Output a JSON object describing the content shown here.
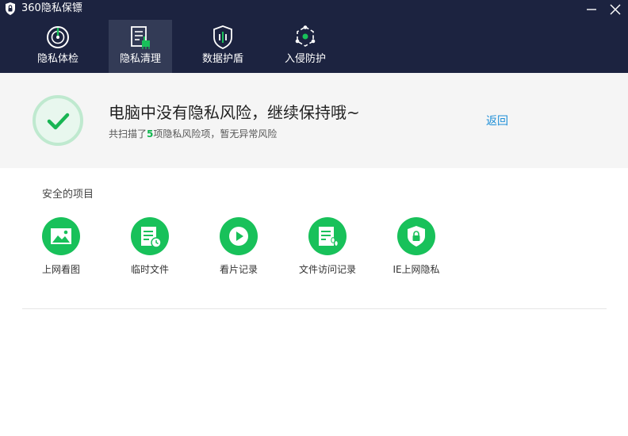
{
  "app": {
    "title": "360隐私保镖"
  },
  "tabs": [
    {
      "label": "隐私体检",
      "icon": "radar-icon"
    },
    {
      "label": "隐私清理",
      "icon": "clean-document-icon"
    },
    {
      "label": "数据护盾",
      "icon": "shield-icon"
    },
    {
      "label": "入侵防护",
      "icon": "network-guard-icon"
    }
  ],
  "active_tab": "隐私清理",
  "result": {
    "title": "电脑中没有隐私风险，继续保持哦~",
    "sub_prefix": "共扫描了",
    "count": "5",
    "sub_suffix": "项隐私风险项，暂无异常风险",
    "back_label": "返回"
  },
  "safe_section": {
    "title": "安全的项目",
    "items": [
      {
        "label": "上网看图",
        "icon": "image-icon"
      },
      {
        "label": "临时文件",
        "icon": "temp-file-icon"
      },
      {
        "label": "看片记录",
        "icon": "play-icon"
      },
      {
        "label": "文件访问记录",
        "icon": "file-footprint-icon"
      },
      {
        "label": "IE上网隐私",
        "icon": "shield-lock-icon"
      }
    ]
  },
  "colors": {
    "header_bg": "#1c2340",
    "active_tab_bg": "#333b56",
    "accent_green": "#18c15a",
    "link_blue": "#1e8fd8"
  }
}
